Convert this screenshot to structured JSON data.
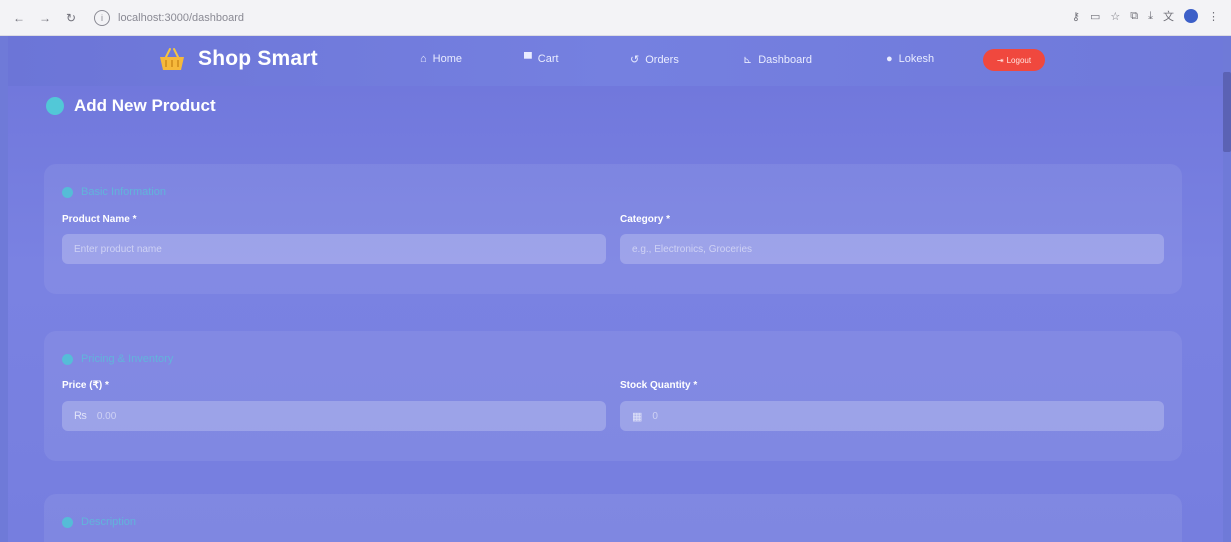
{
  "browser": {
    "url": "localhost:3000/dashboard"
  },
  "header": {
    "brand": "Shop Smart",
    "nav": [
      {
        "label": "Home",
        "icon": "home-icon",
        "glyph": "⌂"
      },
      {
        "label": "Cart",
        "icon": "cart-icon",
        "glyph": "🛒"
      },
      {
        "label": "Orders",
        "icon": "orders-icon",
        "glyph": "⟲"
      },
      {
        "label": "Dashboard",
        "icon": "chart-icon",
        "glyph": "📈"
      },
      {
        "label": "Lokesh",
        "icon": "user-icon",
        "glyph": "●"
      }
    ],
    "logout": "Logout"
  },
  "page": {
    "title": "Add New Product"
  },
  "sections": {
    "basic": {
      "title": "Basic Information",
      "product_name_label": "Product Name *",
      "product_name_placeholder": "Enter product name",
      "category_label": "Category *",
      "category_placeholder": "e.g., Electronics, Groceries"
    },
    "pricing": {
      "title": "Pricing & Inventory",
      "price_label": "Price (₹) *",
      "price_prefix": "₨",
      "price_placeholder": "0.00",
      "stock_label": "Stock Quantity *",
      "stock_prefix": "▦",
      "stock_placeholder": "0"
    },
    "description": {
      "title": "Description"
    }
  },
  "colors": {
    "accent": "#4fd0d6",
    "logout": "#f0483e",
    "background": "#7178dc"
  }
}
